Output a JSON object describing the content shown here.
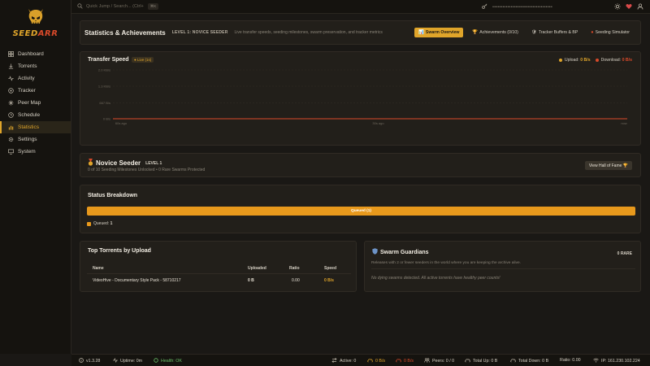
{
  "brand": {
    "prefix": "SEED",
    "suffix": "ARR"
  },
  "search": {
    "placeholder": "Quick Jump / Search... (Ctrl+",
    "shortcut": "⌘K"
  },
  "topbar": {
    "password_mask": "••••••••••••••••••••••••••••••••••••"
  },
  "nav": [
    {
      "label": "Dashboard",
      "icon": "grid-icon"
    },
    {
      "label": "Torrents",
      "icon": "torrent-icon"
    },
    {
      "label": "Activity",
      "icon": "pulse-icon"
    },
    {
      "label": "Tracker",
      "icon": "radar-icon"
    },
    {
      "label": "Peer Map",
      "icon": "map-icon"
    },
    {
      "label": "Schedule",
      "icon": "clock-icon"
    },
    {
      "label": "Statistics",
      "icon": "stats-icon",
      "active": true
    },
    {
      "label": "Settings",
      "icon": "gear-icon"
    },
    {
      "label": "System",
      "icon": "monitor-icon"
    }
  ],
  "header": {
    "title": "Statistics & Achievements",
    "level": "LEVEL 1: NOVICE SEEDER",
    "description": "Live transfer speeds, seeding milestones, swarm preservation, and tracker metrics",
    "tabs": [
      {
        "label": "Swarm Overview",
        "icon": "📊",
        "active": true
      },
      {
        "label": "Achievements (0/10)",
        "icon": "🏆"
      },
      {
        "label": "Tracker Buffers & BP",
        "icon": "🛡"
      },
      {
        "label": "Seeding Simulator",
        "icon": "●"
      }
    ]
  },
  "transfer": {
    "title": "Transfer Speed",
    "live": "● Live (1s)",
    "upload_label": "Upload:",
    "upload_value": "0 B/s",
    "download_label": "Download:",
    "download_value": "0 B/s",
    "colors": {
      "upload": "#e0a52a",
      "download": "#d94a2a"
    }
  },
  "chart_data": {
    "type": "line",
    "title": "Transfer Speed",
    "yticks": [
      "2.0 KB/s",
      "1.3 KB/s",
      "667 B/s",
      "0 B/s"
    ],
    "xticks": [
      "60s ago",
      "30s ago",
      "now"
    ],
    "series": [
      {
        "name": "Upload",
        "color": "#e0a52a",
        "values": [
          0,
          0,
          0
        ]
      },
      {
        "name": "Download",
        "color": "#d94a2a",
        "values": [
          0,
          0,
          0
        ]
      }
    ]
  },
  "novice": {
    "title": "Novice Seeder",
    "level": "LEVEL 1",
    "subtitle": "0 of 10 Seeding Milestones Unlocked • 0 Rare Swarms Protected",
    "button": "View Hall of Fame 🏆"
  },
  "status": {
    "title": "Status Breakdown",
    "bar_label": "Queued (1)",
    "legend_label": "Queued:",
    "legend_count": "1"
  },
  "top_torrents": {
    "title": "Top Torrents by Upload",
    "headers": [
      "Name",
      "Uploaded",
      "Ratio",
      "Speed"
    ],
    "rows": [
      {
        "name": "VideoHive - Documentary Style Pack - 58710217",
        "uploaded": "0 B",
        "ratio": "0.00",
        "speed": "0 B/s"
      }
    ]
  },
  "guardians": {
    "title": "Swarm Guardians",
    "count": "0 RARE",
    "description": "Releases with 2 or fewer seeders in the world where you are keeping the archive alive.",
    "empty": "No dying swarms detected. All active torrents have healthy peer counts!"
  },
  "footer": {
    "version": "v1.3.28",
    "uptime": "Uptime: 0m",
    "health": "Health: OK",
    "active": "Active: 0",
    "up_speed": "0 B/s",
    "down_speed": "0 B/s",
    "peers": "Peers: 0 / 0",
    "total_up": "Total Up: 0 B",
    "total_down": "Total Down: 0 B",
    "ratio": "Ratio: 0.00",
    "ip": "IP: 161.230.102.224"
  }
}
